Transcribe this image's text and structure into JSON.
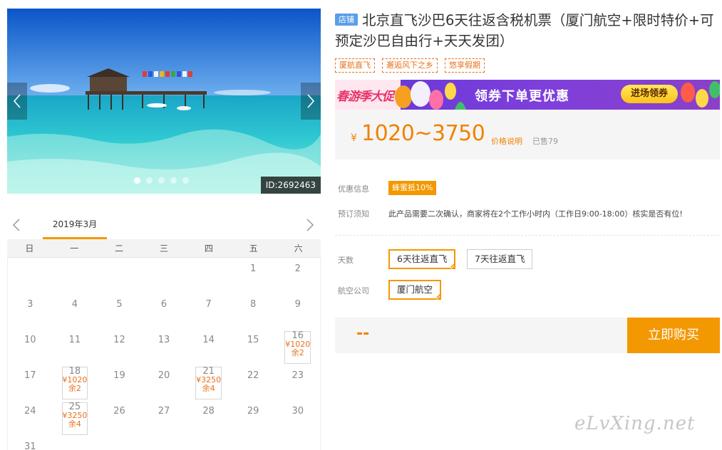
{
  "hero": {
    "image_id": "ID:2692463",
    "icons": {
      "prev": "chevron-left-icon",
      "next": "chevron-right-icon"
    },
    "active_slide": 1
  },
  "calendar": {
    "month": "2019年3月",
    "weekdays": [
      "日",
      "一",
      "二",
      "三",
      "四",
      "五",
      "六"
    ],
    "weeks": [
      [
        null,
        null,
        null,
        null,
        null,
        {
          "day": "1"
        },
        {
          "day": "2"
        }
      ],
      [
        {
          "day": "3"
        },
        {
          "day": "4"
        },
        {
          "day": "5"
        },
        {
          "day": "6"
        },
        {
          "day": "7"
        },
        {
          "day": "8"
        },
        {
          "day": "9"
        }
      ],
      [
        {
          "day": "10"
        },
        {
          "day": "11"
        },
        {
          "day": "12"
        },
        {
          "day": "13"
        },
        {
          "day": "14"
        },
        {
          "day": "15"
        },
        {
          "day": "16",
          "price": "¥1020",
          "stock": "余2"
        }
      ],
      [
        {
          "day": "17"
        },
        {
          "day": "18",
          "price": "¥1020",
          "stock": "余2"
        },
        {
          "day": "19"
        },
        {
          "day": "20"
        },
        {
          "day": "21",
          "price": "¥3250",
          "stock": "余4"
        },
        {
          "day": "22"
        },
        {
          "day": "23"
        }
      ],
      [
        {
          "day": "24"
        },
        {
          "day": "25",
          "price": "¥3250",
          "stock": "余4"
        },
        {
          "day": "26"
        },
        {
          "day": "27"
        },
        {
          "day": "28"
        },
        {
          "day": "29"
        },
        {
          "day": "30"
        }
      ],
      [
        {
          "day": "31"
        },
        null,
        null,
        null,
        null,
        null,
        null
      ]
    ]
  },
  "product": {
    "shop_badge": "店铺",
    "title": "北京直飞沙巴6天往返含税机票（厦门航空+限时特价+可预定沙巴自由行+天天发团）",
    "tags": [
      "厦航直飞",
      "邂逅风下之乡",
      "悠享假期"
    ]
  },
  "banner": {
    "spring_text": "春游季大促",
    "slogan": "领券下单更优惠",
    "button": "进场领券"
  },
  "price": {
    "currency": "¥",
    "range": "1020~3750",
    "note_link": "价格说明",
    "sold": "已售79"
  },
  "info": {
    "promo_label": "优惠信息",
    "promo_badge": "蜂蜜抵10%",
    "notice_label": "预订须知",
    "notice_text": "此产品需要二次确认，商家将在2个工作小时内（工作日9:00-18:00）核实是否有位!"
  },
  "options": {
    "days_label": "天数",
    "days": [
      {
        "label": "6天往返直飞",
        "selected": true
      },
      {
        "label": "7天往返直飞",
        "selected": false
      }
    ],
    "airline_label": "航空公司",
    "airlines": [
      {
        "label": "厦门航空",
        "selected": true
      }
    ]
  },
  "purchase": {
    "total": "--",
    "buy_button": "立即购买"
  },
  "watermark": "eLvXing.net",
  "colors": {
    "accent": "#f39800",
    "price": "#f08200",
    "badge_blue": "#5b9ee8"
  }
}
